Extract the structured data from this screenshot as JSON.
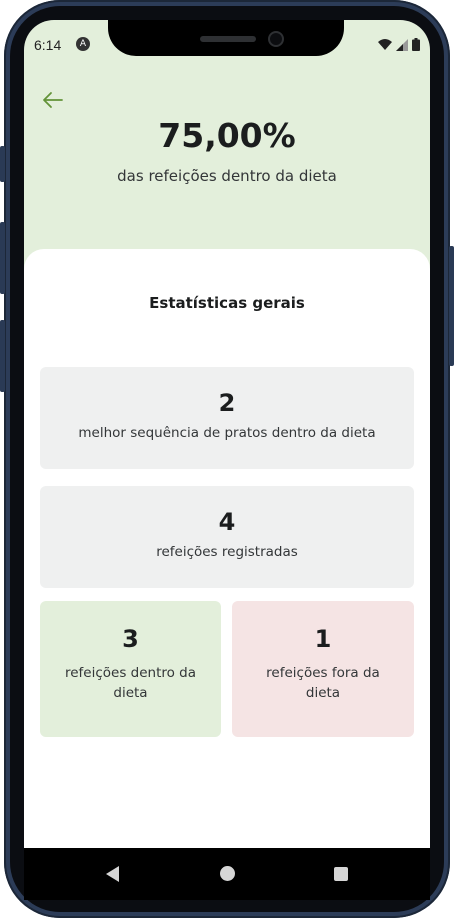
{
  "status_bar": {
    "time": "6:14",
    "app_icon": "A",
    "icons": [
      "wifi-icon",
      "signal-icon",
      "battery-icon"
    ]
  },
  "header": {
    "back_icon": "arrow-left-icon",
    "percentage": "75,00%",
    "subtitle": "das refeições dentro da dieta"
  },
  "stats": {
    "title": "Estatísticas gerais",
    "best_sequence": {
      "value": "2",
      "label": "melhor sequência de pratos dentro da dieta"
    },
    "registered": {
      "value": "4",
      "label": "refeições registradas"
    },
    "within_diet": {
      "value": "3",
      "label_line1": "refeições dentro da",
      "label_line2": "dieta"
    },
    "outside_diet": {
      "value": "1",
      "label_line1": "refeições fora da",
      "label_line2": "dieta"
    }
  },
  "colors": {
    "header_bg": "#e3efdb",
    "accent_green": "#639339",
    "card_gray": "#eff0f0",
    "card_green": "#e3efdb",
    "card_red": "#f5e4e4"
  },
  "navigation_bar": {
    "buttons": [
      "nav-back-icon",
      "nav-home-icon",
      "nav-recents-icon"
    ]
  }
}
